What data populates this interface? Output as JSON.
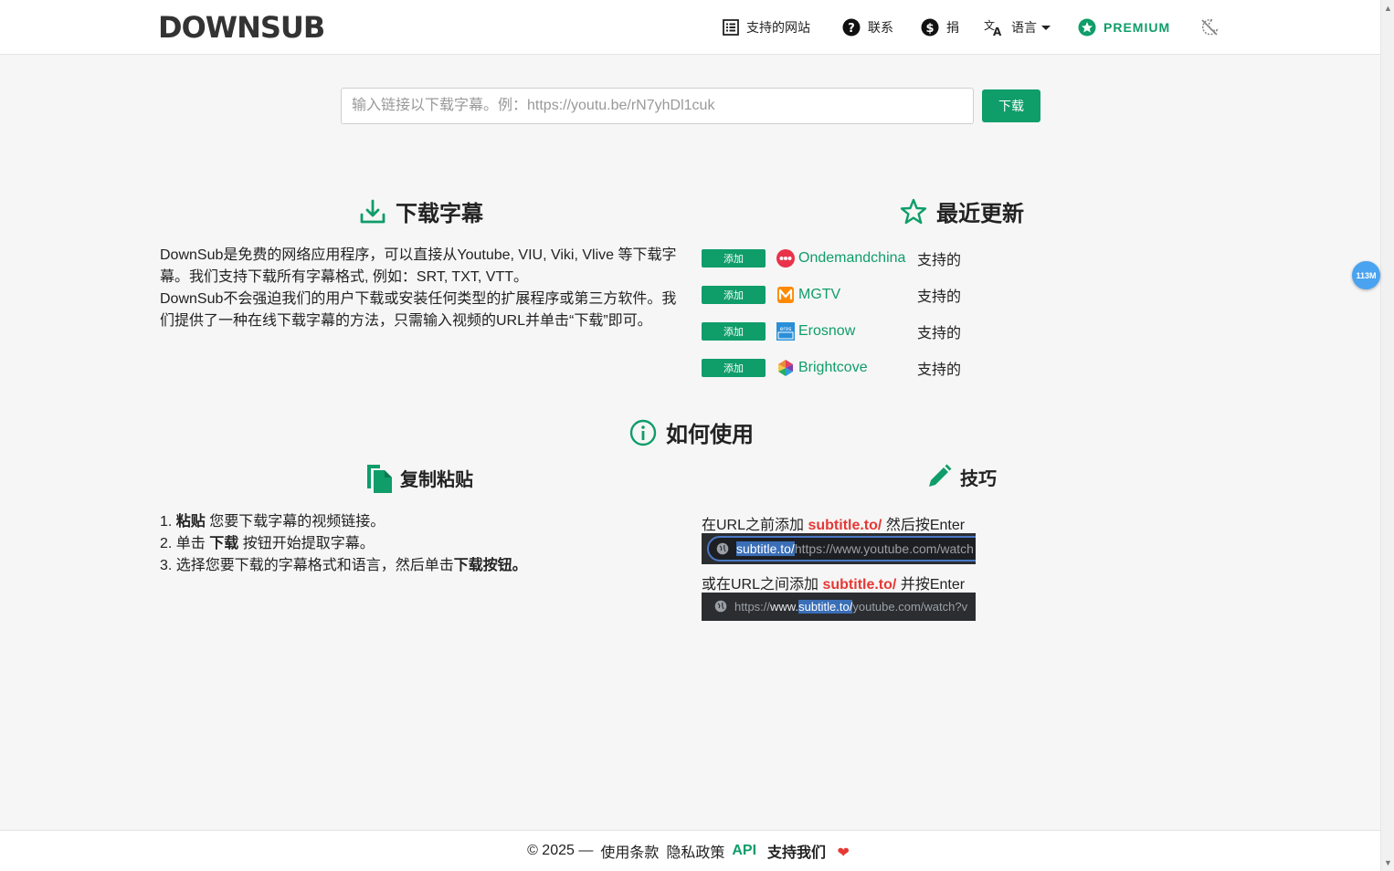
{
  "header": {
    "logo": "DOWNSUB",
    "nav": {
      "supported_sites": "支持的网站",
      "contact": "联系",
      "donate": "捐",
      "language": "语言",
      "premium": "PREMIUM"
    }
  },
  "search": {
    "placeholder": "输入链接以下载字幕。例：https://youtu.be/rN7yhDl1cuk",
    "value": "",
    "button": "下载"
  },
  "download_section": {
    "title": "下载字幕",
    "paragraph_1": "DownSub是免费的网络应用程序，可以直接从Youtube, VIU, Viki, Vlive 等下载字幕。我们支持下载所有字幕格式, 例如：SRT, TXT, VTT。",
    "paragraph_2": "DownSub不会强迫我们的用户下载或安装任何类型的扩展程序或第三方软件。我们提供了一种在线下载字幕的方法，只需输入视频的URL并单击“下载”即可。"
  },
  "updates_section": {
    "title": "最近更新",
    "items": [
      {
        "badge": "添加",
        "site": "Ondemandchina",
        "status": "支持的",
        "icon": "ondemandchina-icon",
        "color": "#e8334a"
      },
      {
        "badge": "添加",
        "site": "MGTV",
        "status": "支持的",
        "icon": "mgtv-icon",
        "color": "#ff6a00"
      },
      {
        "badge": "添加",
        "site": "Erosnow",
        "status": "支持的",
        "icon": "erosnow-icon",
        "color": "#2a8fd8"
      },
      {
        "badge": "添加",
        "site": "Brightcove",
        "status": "支持的",
        "icon": "brightcove-icon",
        "color": "#7b3fb2"
      }
    ]
  },
  "howto_section": {
    "title": "如何使用",
    "copy_paste": {
      "title": "复制粘贴",
      "step1_num": "1.",
      "step1_bold": "粘贴",
      "step1_text": "您要下载字幕的视频链接。",
      "step2_num": "2. 单击",
      "step2_bold": "下载",
      "step2_text": "按钮开始提取字幕。",
      "step3_text": "3. 选择您要下载的字幕格式和语言，然后单击",
      "step3_bold": "下载按钮。"
    },
    "tips": {
      "title": "技巧",
      "tip1_pre": "在URL之前添加",
      "tip1_code": "subtitle.to/",
      "tip1_post": "然后按Enter",
      "bar1_hl": "subtitle.to/",
      "bar1_rest": "https://www.youtube.com/watch",
      "tip2_pre": "或在URL之间添加",
      "tip2_code": "subtitle.to/",
      "tip2_post": "并按Enter",
      "bar2_a": "https://",
      "bar2_b": "www.",
      "bar2_hl": "subtitle.to/",
      "bar2_rest": "youtube.com/watch?v"
    }
  },
  "footer": {
    "copyright": "© 2025 —",
    "terms": "使用条款",
    "privacy": "隐私政策",
    "api": "API",
    "support": "支持我们",
    "heart": "❤"
  },
  "float_badge": "113M",
  "colors": {
    "accent": "#0f9d6a",
    "red": "#e53935"
  }
}
